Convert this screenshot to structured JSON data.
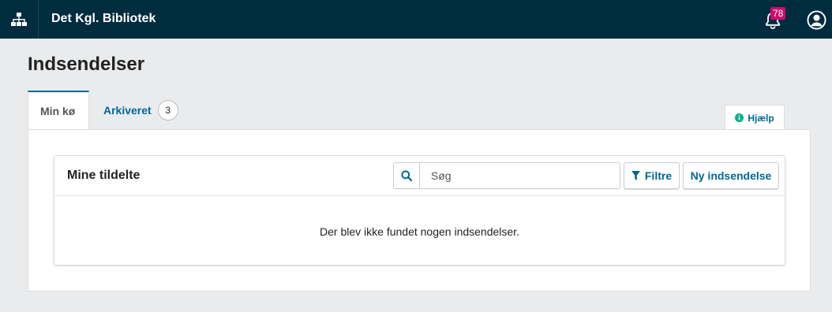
{
  "header": {
    "site_title": "Det Kgl. Bibliotek",
    "notifications_count": "78",
    "icons": {
      "sitemap": "sitemap-icon",
      "bell": "bell-icon",
      "user": "user-circle-icon"
    }
  },
  "page": {
    "title": "Indsendelser"
  },
  "tabs": [
    {
      "label": "Min kø",
      "active": true
    },
    {
      "label": "Arkiveret",
      "badge": "3",
      "active": false
    }
  ],
  "help": {
    "label": "Hjælp"
  },
  "list": {
    "title": "Mine tildelte",
    "search_placeholder": "Søg",
    "filter_label": "Filtre",
    "new_label": "Ny indsendelse",
    "empty_message": "Der blev ikke fundet nogen indsendelser."
  },
  "colors": {
    "header_bg": "#002c40",
    "accent": "#006798",
    "badge_bg": "#d00a6c",
    "help_icon": "#00b28d"
  }
}
